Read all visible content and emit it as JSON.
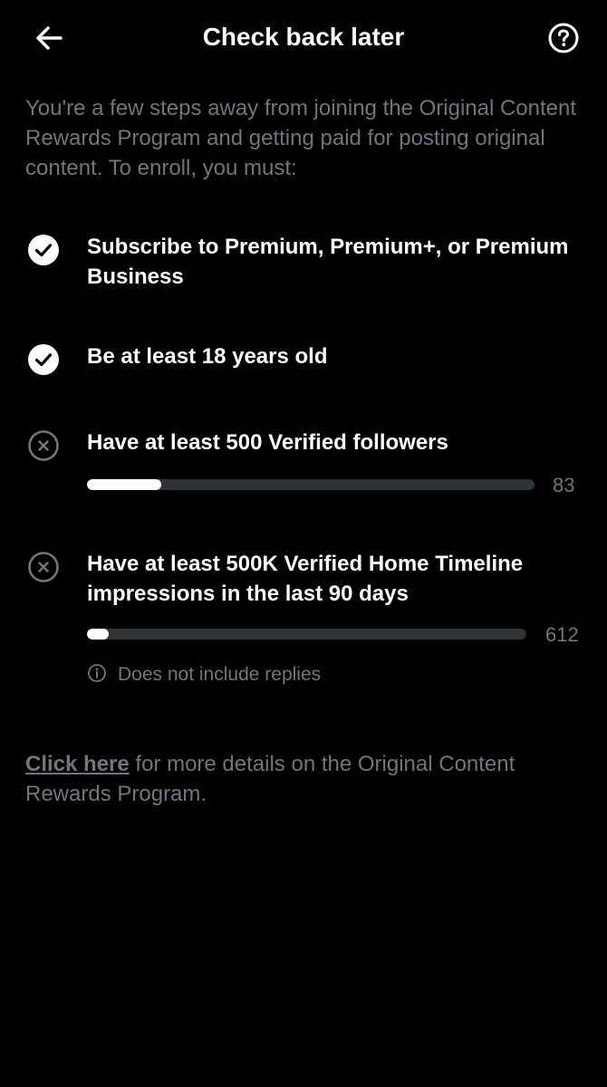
{
  "header": {
    "title": "Check back later",
    "back_icon": "arrow-left-icon",
    "help_icon": "question-circle-icon"
  },
  "intro_text": "You're a few steps away from joining the Original Content Rewards Program and getting paid for posting original content. To enroll, you must:",
  "requirements": [
    {
      "label": "Subscribe to Premium, Premium+, or Premium Business",
      "status": "met",
      "icon": "check-circle-icon"
    },
    {
      "label": "Be at least 18 years old",
      "status": "met",
      "icon": "check-circle-icon"
    },
    {
      "label": "Have at least 500 Verified followers",
      "status": "not-met",
      "icon": "x-circle-icon",
      "progress": {
        "current": 83,
        "current_text": "83",
        "goal": 500
      }
    },
    {
      "label": "Have at least 500K Verified Home Timeline impressions in the last 90 days",
      "status": "not-met",
      "icon": "x-circle-icon",
      "progress": {
        "current": 612,
        "current_text": "612",
        "goal": 500000,
        "displayed_fill_fraction": 0.05
      },
      "note": {
        "text": "Does not include replies",
        "icon": "info-icon"
      }
    }
  ],
  "footer": {
    "link_text": "Click here",
    "rest_text": " for more details on the Original Content Rewards Program."
  },
  "colors": {
    "background": "#000000",
    "primary_text": "#ffffff",
    "secondary_text": "#71767b",
    "track": "#2f3336",
    "fill": "#ffffff"
  }
}
